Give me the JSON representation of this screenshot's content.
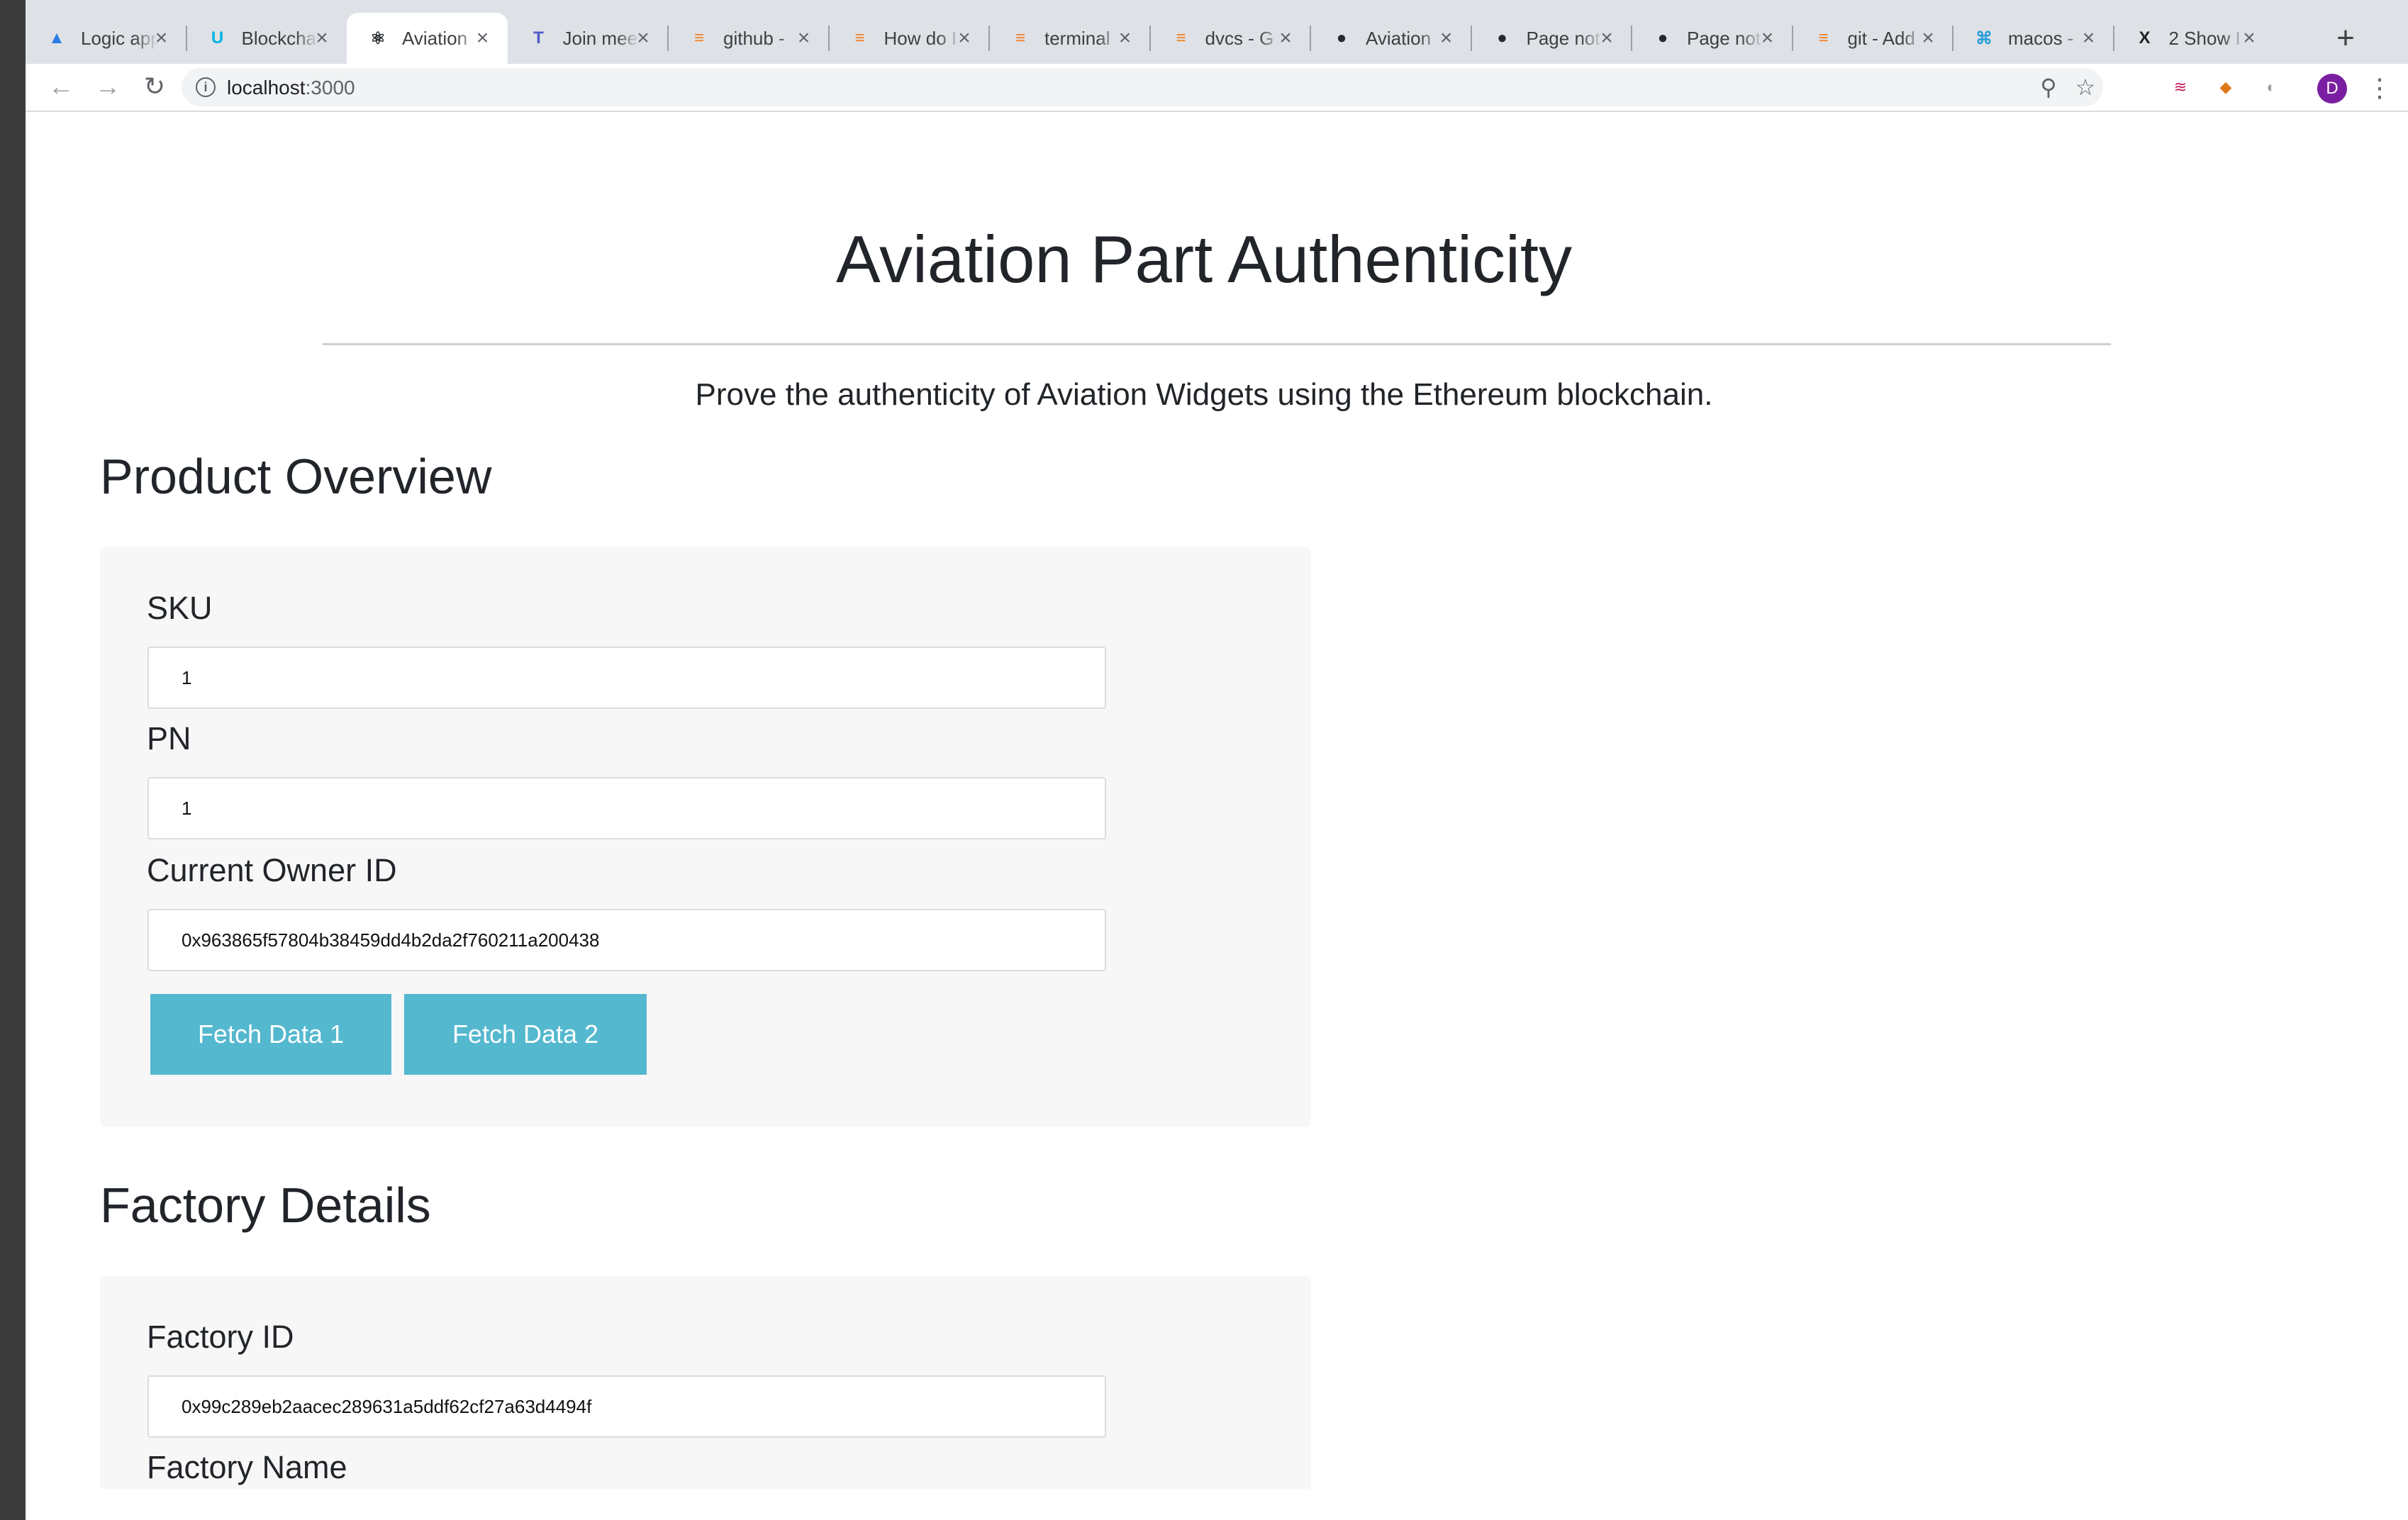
{
  "browser": {
    "tabs": [
      {
        "title": "Logic app",
        "favicon": "azure-icon",
        "color": "#2c7be5",
        "glyph": "▲"
      },
      {
        "title": "Blockchain",
        "favicon": "udacity-icon",
        "color": "#02b3e4",
        "glyph": "U"
      },
      {
        "title": "Aviation",
        "favicon": "react-icon",
        "color": "#20232a",
        "glyph": "⚛",
        "active": true
      },
      {
        "title": "Join meeting",
        "favicon": "teams-icon",
        "color": "#5059c9",
        "glyph": "T"
      },
      {
        "title": "github -",
        "favicon": "stackoverflow-icon",
        "color": "#f48024",
        "glyph": "≡"
      },
      {
        "title": "How do I",
        "favicon": "stackoverflow-icon",
        "color": "#f48024",
        "glyph": "≡"
      },
      {
        "title": "terminal",
        "favicon": "stackoverflow-icon",
        "color": "#f48024",
        "glyph": "≡"
      },
      {
        "title": "dvcs - G",
        "favicon": "stackoverflow-icon",
        "color": "#f48024",
        "glyph": "≡"
      },
      {
        "title": "Aviation",
        "favicon": "github-icon",
        "color": "#24292e",
        "glyph": "●"
      },
      {
        "title": "Page not",
        "favicon": "github-icon",
        "color": "#24292e",
        "glyph": "●"
      },
      {
        "title": "Page not",
        "favicon": "github-icon",
        "color": "#24292e",
        "glyph": "●"
      },
      {
        "title": "git - Add",
        "favicon": "stackoverflow-icon",
        "color": "#f48024",
        "glyph": "≡"
      },
      {
        "title": "macos -",
        "favicon": "superuser-icon",
        "color": "#2d9fd8",
        "glyph": "⌘"
      },
      {
        "title": "2 Show I",
        "favicon": "x-icon",
        "color": "#222222",
        "glyph": "X"
      }
    ],
    "url_host": "localhost",
    "url_port": ":3000"
  },
  "page": {
    "title": "Aviation Part Authenticity",
    "lead": "Prove the authenticity of Aviation Widgets using the Ethereum blockchain."
  },
  "product_overview": {
    "heading": "Product Overview",
    "sku_label": "SKU",
    "sku_value": "1",
    "pn_label": "PN",
    "pn_value": "1",
    "owner_label": "Current Owner ID",
    "owner_value": "0x963865f57804b38459dd4b2da2f760211a200438",
    "fetch1_label": "Fetch Data 1",
    "fetch2_label": "Fetch Data 2"
  },
  "factory_details": {
    "heading": "Factory Details",
    "factory_id_label": "Factory ID",
    "factory_id_value": "0x99c289eb2aacec289631a5ddf62cf27a63d4494f",
    "factory_name_label": "Factory Name"
  }
}
